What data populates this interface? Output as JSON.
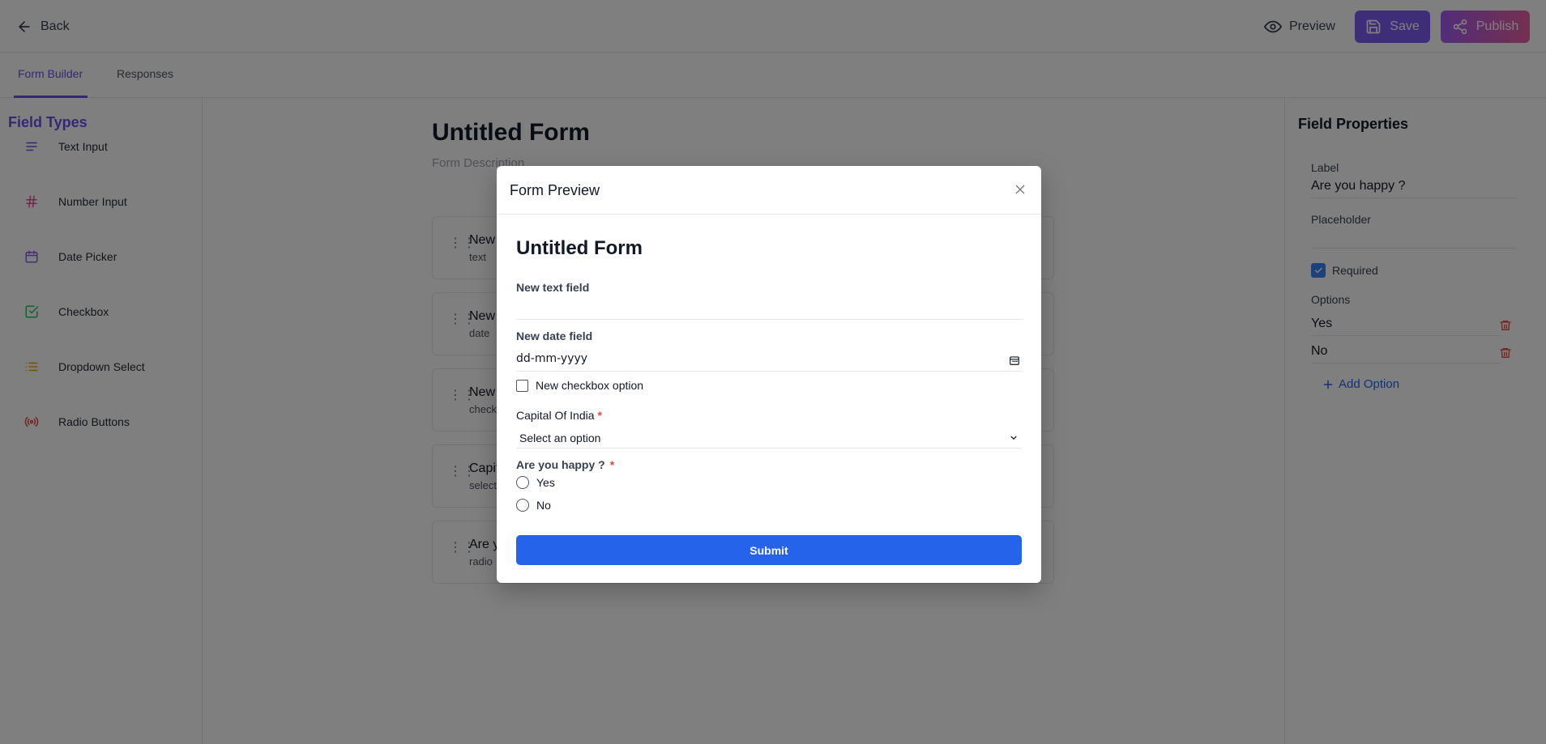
{
  "header": {
    "back_label": "Back",
    "preview_label": "Preview",
    "save_label": "Save",
    "publish_label": "Publish"
  },
  "tabs": [
    {
      "label": "Form Builder",
      "active": true
    },
    {
      "label": "Responses",
      "active": false
    }
  ],
  "sidebar": {
    "title": "Field Types",
    "items": [
      {
        "label": "Text Input",
        "icon": "text-lines-icon",
        "color": "#6d4ee8"
      },
      {
        "label": "Number Input",
        "icon": "hash-icon",
        "color": "#ec4899"
      },
      {
        "label": "Date Picker",
        "icon": "calendar-icon",
        "color": "#8b5cf6"
      },
      {
        "label": "Checkbox",
        "icon": "check-square-icon",
        "color": "#22c55e"
      },
      {
        "label": "Dropdown Select",
        "icon": "list-icon",
        "color": "#f59e0b"
      },
      {
        "label": "Radio Buttons",
        "icon": "radio-broadcast-icon",
        "color": "#ef4444"
      }
    ]
  },
  "canvas": {
    "form_title": "Untitled Form",
    "form_description": "Form Description",
    "fields": [
      {
        "title": "New",
        "subtitle": "text"
      },
      {
        "title": "New",
        "subtitle": "date"
      },
      {
        "title": "New",
        "subtitle": "check"
      },
      {
        "title": "Capit",
        "subtitle": "select"
      },
      {
        "title": "Are y",
        "subtitle": "radio"
      }
    ]
  },
  "properties": {
    "title": "Field Properties",
    "label_caption": "Label",
    "label_value": "Are you happy ?",
    "placeholder_caption": "Placeholder",
    "placeholder_value": "",
    "required_label": "Required",
    "required_checked": true,
    "options_caption": "Options",
    "options": [
      "Yes",
      "No"
    ],
    "add_option_label": "Add Option"
  },
  "modal": {
    "title": "Form Preview",
    "form_title": "Untitled Form",
    "text_field_label": "New text field",
    "date_field_label": "New date field",
    "date_placeholder": "dd-mm-yyyy",
    "checkbox_label": "New checkbox option",
    "select_label": "Capital Of India",
    "select_required_mark": "*",
    "select_value": "Select an option",
    "radio_label": "Are you happy ?",
    "radio_required_mark": "*",
    "radio_options": [
      "Yes",
      "No"
    ],
    "submit_label": "Submit"
  },
  "colors": {
    "accent": "#6d4ee8",
    "primary_button": "#2563eb",
    "required": "#ef4444",
    "overlay": "rgba(0,0,0,0.5)"
  }
}
